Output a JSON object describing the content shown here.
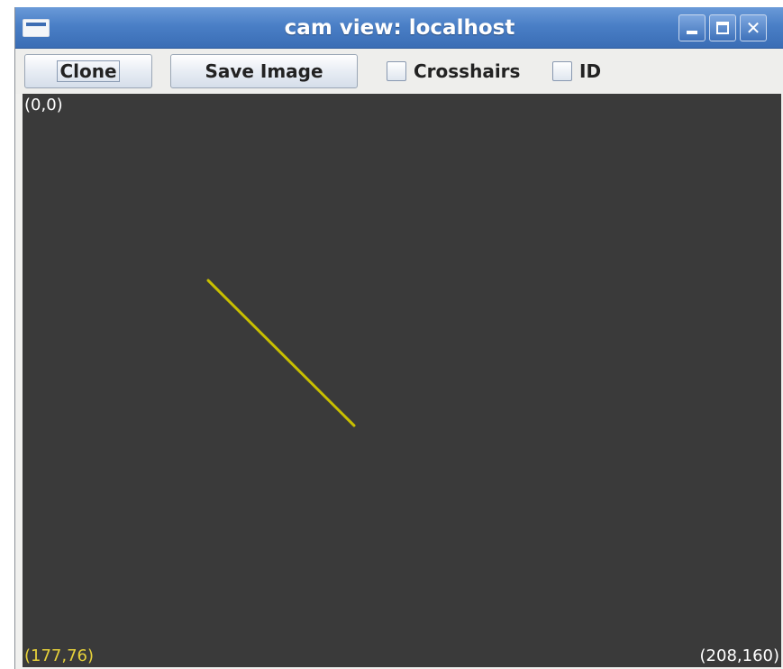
{
  "window": {
    "title": "cam view: localhost"
  },
  "toolbar": {
    "clone_label": "Clone",
    "save_image_label": "Save Image",
    "crosshairs_label": "Crosshairs",
    "crosshairs_checked": false,
    "id_label": "ID",
    "id_checked": false
  },
  "viewport": {
    "background_color": "#3a3a3a",
    "origin_label": "(0,0)",
    "cursor_label": "(177,76)",
    "size_label": "(208,160)",
    "cursor_label_color": "#e6d13a",
    "line_color": "#c8bf00"
  },
  "icons": {
    "window_menu": "window-menu-icon",
    "minimize": "minimize-icon",
    "maximize": "maximize-icon",
    "close": "close-icon"
  }
}
